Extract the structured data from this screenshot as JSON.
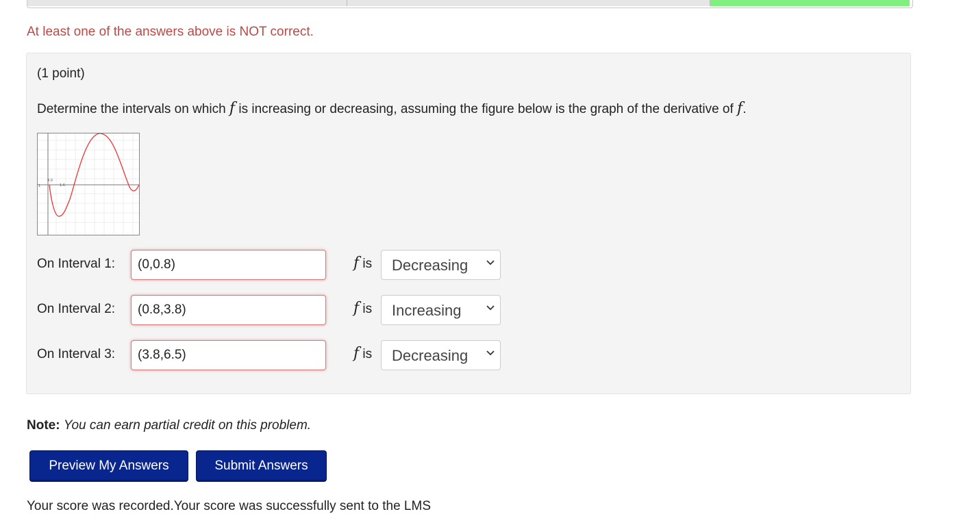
{
  "status": {
    "message": "At least one of the answers above is NOT correct.",
    "results": [
      "incorrect",
      "incorrect",
      "correct"
    ]
  },
  "problem": {
    "points": "(1 point)",
    "question_before": "Determine the intervals on which ",
    "question_f1": "f",
    "question_middle": " is increasing or decreasing, assuming the figure below is the graph of the derivative of ",
    "question_f2": "f",
    "question_end": ".",
    "graph": {
      "description": "graph of f′ (derivative)",
      "x_ticks_visible": [
        "1",
        "4.0",
        "1.6"
      ],
      "curve_color": "#e8373a"
    },
    "intervals": [
      {
        "label": "On Interval 1:",
        "value": "(0,0.8)",
        "f": "f",
        "is": " is",
        "selected": "Decreasing"
      },
      {
        "label": "On Interval 2:",
        "value": "(0.8,3.8)",
        "f": "f",
        "is": " is",
        "selected": "Increasing"
      },
      {
        "label": "On Interval 3:",
        "value": "(3.8,6.5)",
        "f": "f",
        "is": " is",
        "selected": "Decreasing"
      }
    ]
  },
  "note": {
    "label": "Note:",
    "text": "You can earn partial credit on this problem."
  },
  "buttons": {
    "preview": "Preview My Answers",
    "submit": "Submit Answers"
  },
  "footer": {
    "score": "Your score was recorded.Your score was successfully sent to the LMS"
  },
  "colors": {
    "error_text": "#b94a48",
    "button_bg": "#08268e",
    "correct_green": "#7ff07f",
    "input_error_border": "#e07474"
  }
}
